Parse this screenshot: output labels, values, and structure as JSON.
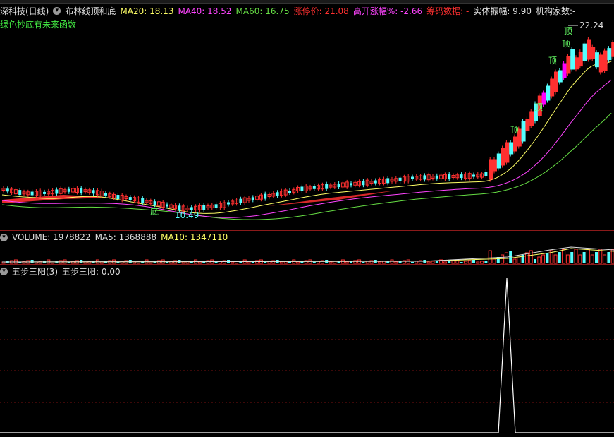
{
  "header": {
    "stock": "深科技(日线)",
    "indicator": "布林线顶和底",
    "ma20_label": "MA20:",
    "ma20": "18.13",
    "ma40_label": "MA40:",
    "ma40": "18.52",
    "ma60_label": "MA60:",
    "ma60": "16.75",
    "limit_label": "涨停价:",
    "limit": "21.08",
    "gap_label": "高开涨幅%:",
    "gap": "-2.66",
    "chip_label": "筹码数据:",
    "chip": "-",
    "body_label": "实体振幅:",
    "body": "9.90",
    "inst_label": "机构家数:",
    "inst": "-",
    "note": "绿色抄底有未来函数"
  },
  "price_chart": {
    "high_label": "22.24",
    "low_label": "10.49",
    "top_marker": "顶",
    "bottom_marker": "底"
  },
  "volume": {
    "label": "VOLUME:",
    "value": "1978822",
    "ma5_label": "MA5:",
    "ma5": "1368888",
    "ma10_label": "MA10:",
    "ma10": "1347110"
  },
  "indicator3": {
    "title": "五步三阳(3)",
    "value_label": "五步三阳:",
    "value": "0.00"
  },
  "colors": {
    "up": "#ff3030",
    "down": "#54ffff",
    "ma20": "#ffff66",
    "ma40": "#ff44ff",
    "ma60": "#66dd44",
    "magenta_bar": "#ff00ff",
    "grid": "#7a1010"
  }
}
